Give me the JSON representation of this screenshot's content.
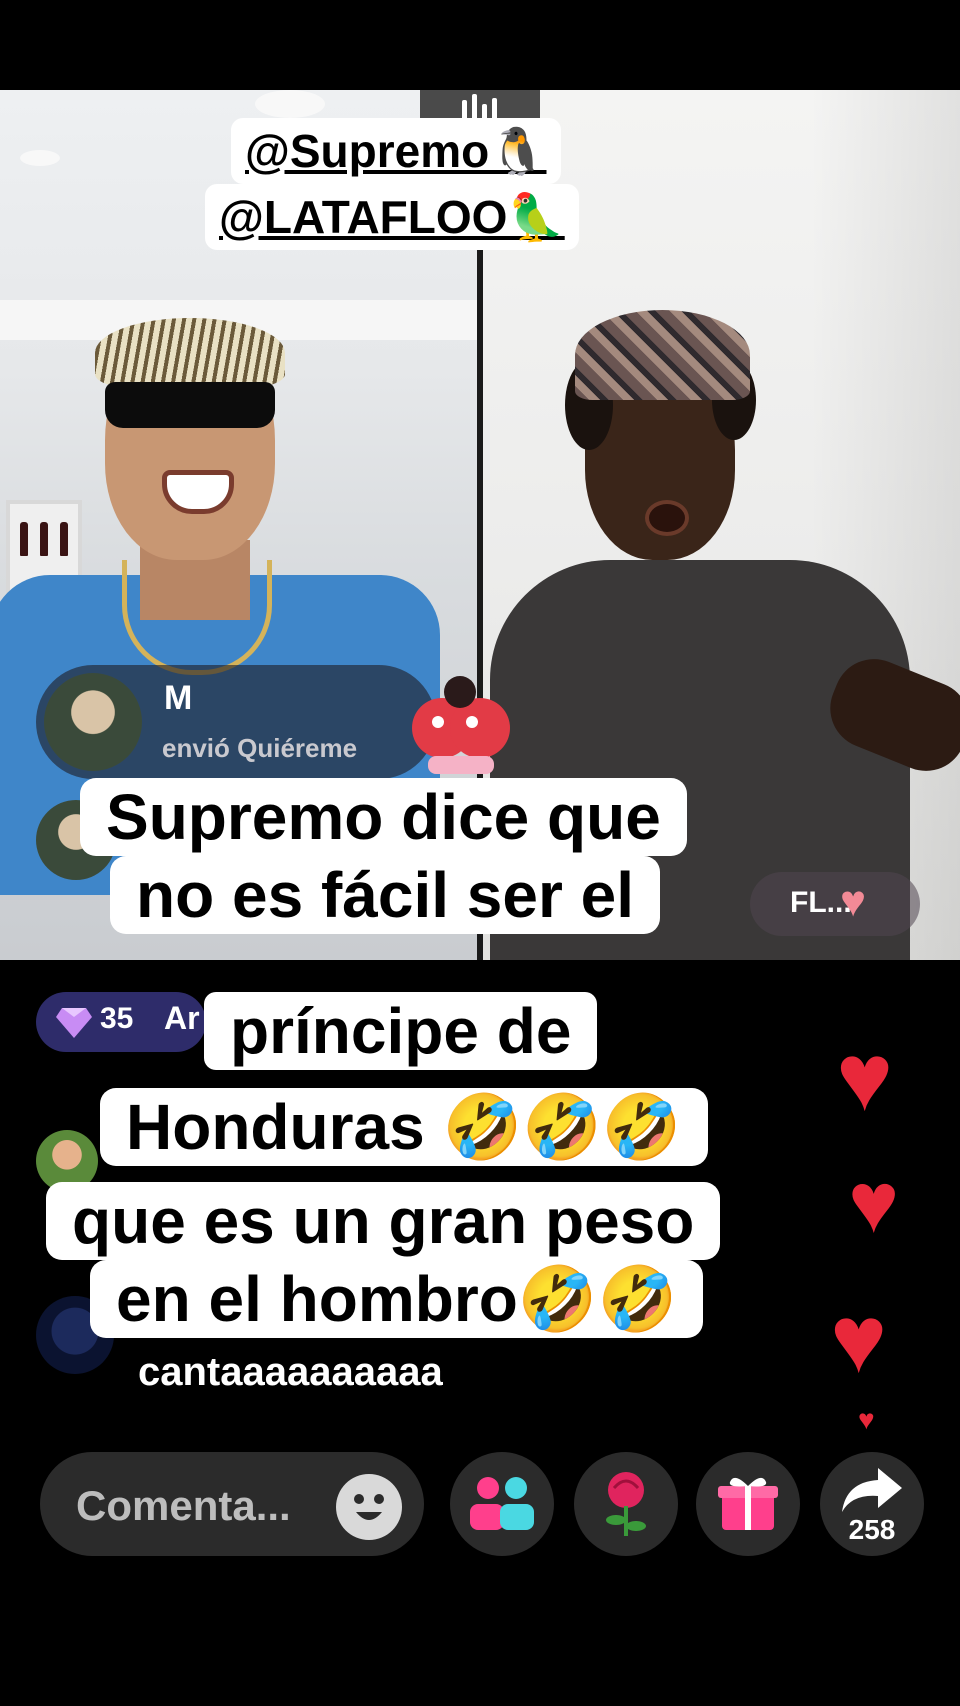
{
  "tags": {
    "line1": "@Supremo🐧",
    "line2": "@LATAFLOO🦜"
  },
  "gift_notice": {
    "user": "M",
    "text": "envió Quiéreme"
  },
  "right_badge": {
    "text": "FL..."
  },
  "diamond_badge": {
    "count": "35",
    "name": "Ar"
  },
  "comment_partial": "cantaaaaaaaaaa",
  "caption": {
    "line1": "Supremo dice que",
    "line2": "no es fácil  ser el",
    "line3": "príncipe de",
    "line4": "Honduras 🤣🤣🤣",
    "line5": "que es un gran peso",
    "line6": "en el hombro🤣🤣"
  },
  "bottom_bar": {
    "comment_placeholder": "Comenta...",
    "share_count": "258"
  },
  "colors": {
    "heart": "#e9283a",
    "caption_bg": "#ffffff",
    "bottom_button_bg": "#2b2b2b",
    "diamond_badge_bg": "#2e2c6a"
  },
  "icons": [
    "audio-bars-icon",
    "emoji-icon",
    "guests-icon",
    "rose-gift-icon",
    "gift-box-icon",
    "share-arrow-icon",
    "heart-icon",
    "diamond-icon"
  ]
}
